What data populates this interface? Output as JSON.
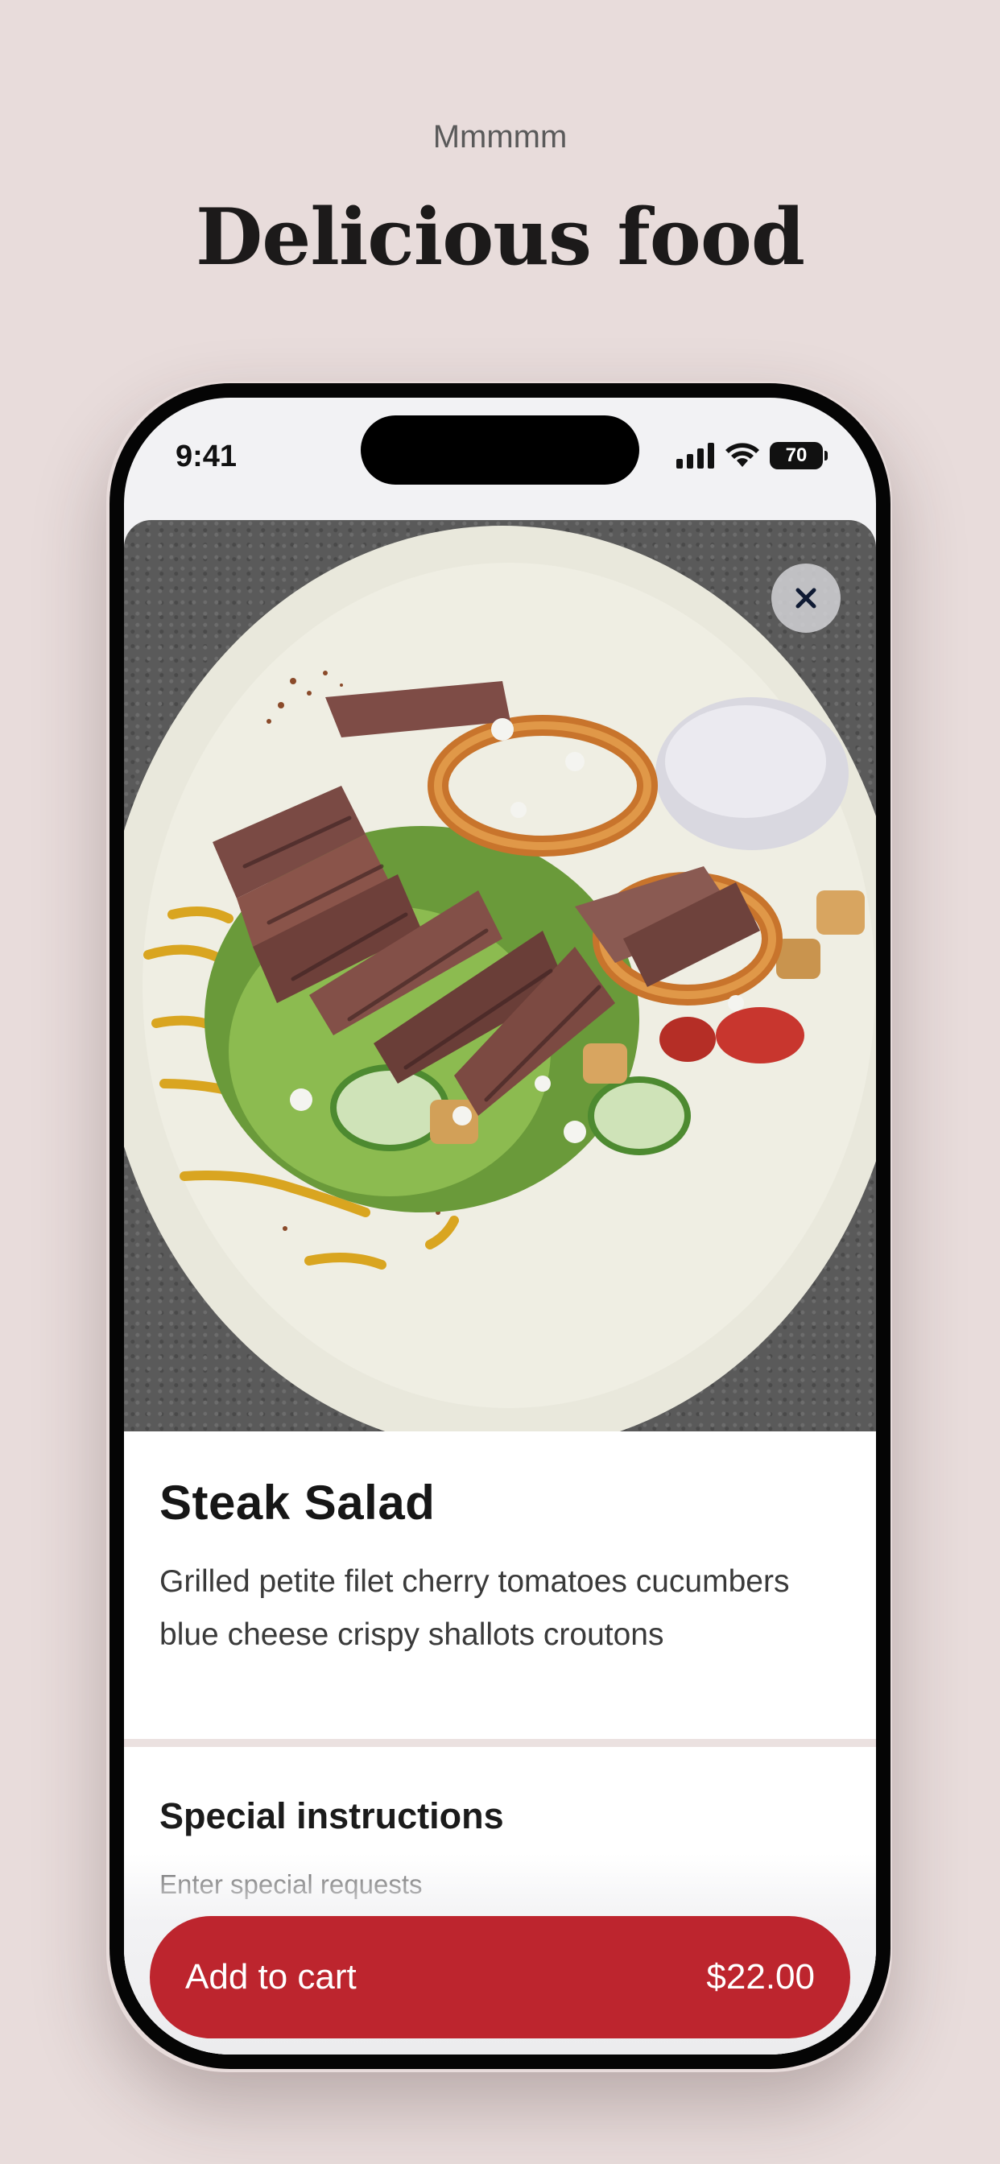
{
  "header": {
    "kicker": "Mmmmm",
    "headline": "Delicious food"
  },
  "status_bar": {
    "time": "9:41",
    "battery": "70",
    "icons": [
      "cellular-signal-icon",
      "wifi-icon",
      "battery-icon"
    ]
  },
  "item": {
    "image": "steak-salad-photo",
    "close_icon": "close-icon",
    "title": "Steak Salad",
    "description": "Grilled petite filet cherry tomatoes cucumbers blue cheese crispy shallots croutons"
  },
  "special_instructions": {
    "title": "Special instructions",
    "placeholder": "Enter special requests"
  },
  "cart": {
    "label": "Add to cart",
    "price": "$22.00"
  },
  "colors": {
    "page_background": "#e8dcdb",
    "accent": "#bd252e",
    "divider": "#ebe1e0"
  }
}
